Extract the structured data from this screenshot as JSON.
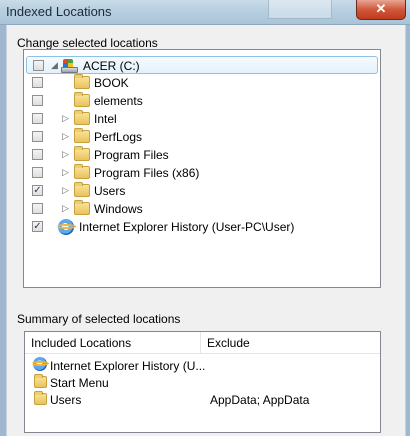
{
  "window": {
    "title": "Indexed Locations",
    "close_glyph": "✕"
  },
  "change_section": {
    "label": "Change selected locations",
    "tree": [
      {
        "label": "ACER (C:)",
        "checked": false,
        "expander": "◢",
        "icon": "drive-icon",
        "indent": 0,
        "selected": true
      },
      {
        "label": "BOOK",
        "checked": false,
        "expander": "",
        "icon": "folder-icon",
        "indent": 1
      },
      {
        "label": "elements",
        "checked": false,
        "expander": "",
        "icon": "folder-icon",
        "indent": 1
      },
      {
        "label": "Intel",
        "checked": false,
        "expander": "▷",
        "icon": "folder-icon",
        "indent": 1
      },
      {
        "label": "PerfLogs",
        "checked": false,
        "expander": "▷",
        "icon": "folder-icon",
        "indent": 1
      },
      {
        "label": "Program Files",
        "checked": false,
        "expander": "▷",
        "icon": "folder-icon",
        "indent": 1
      },
      {
        "label": "Program Files (x86)",
        "checked": false,
        "expander": "▷",
        "icon": "folder-icon",
        "indent": 1
      },
      {
        "label": "Users",
        "checked": true,
        "expander": "▷",
        "icon": "folder-icon",
        "indent": 1
      },
      {
        "label": "Windows",
        "checked": false,
        "expander": "▷",
        "icon": "folder-icon",
        "indent": 1
      },
      {
        "label": "Internet Explorer History (User-PC\\User)",
        "checked": true,
        "expander": "",
        "icon": "ie-icon",
        "indent": 0
      }
    ]
  },
  "summary_section": {
    "label": "Summary of selected locations",
    "columns": {
      "included": "Included Locations",
      "exclude": "Exclude"
    },
    "rows": [
      {
        "location": "Internet Explorer History (U...",
        "exclude": "",
        "icon": "ie-icon"
      },
      {
        "location": "Start Menu",
        "exclude": "",
        "icon": "folder-icon"
      },
      {
        "location": "Users",
        "exclude": "AppData; AppData",
        "icon": "folder-icon"
      }
    ]
  },
  "colors": {
    "selection_border": "#8fc1e6",
    "close_button": "#c03a1d"
  }
}
